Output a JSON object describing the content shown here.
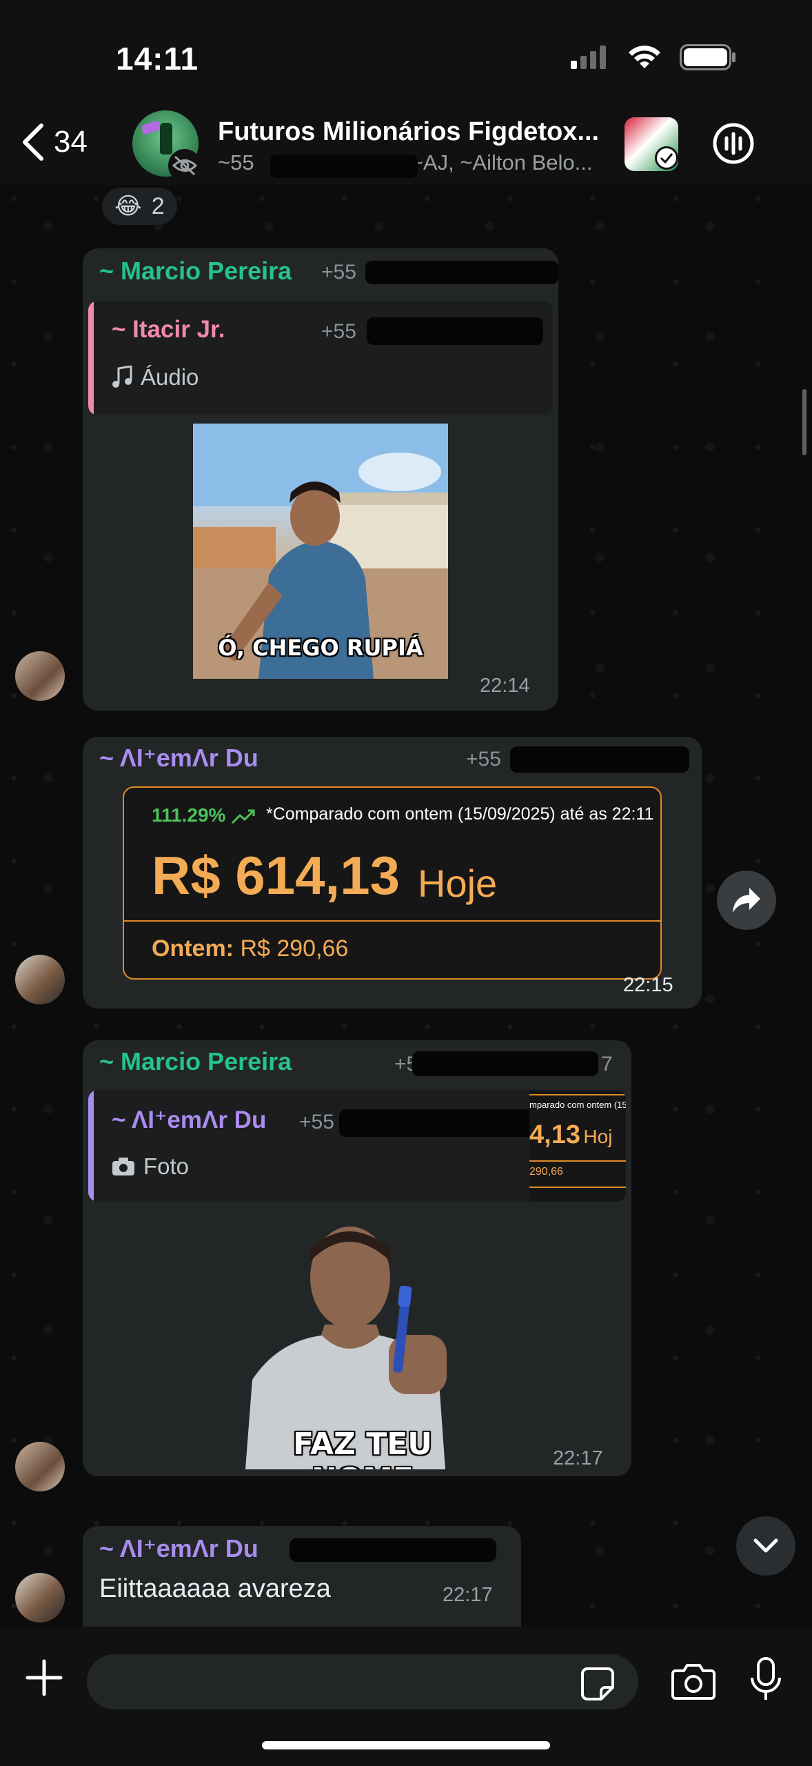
{
  "status_bar": {
    "time": "14:11"
  },
  "header": {
    "back_count": "34",
    "group_title": "Futuros Milionários Figdetox...",
    "members_prefix": "~55",
    "members_suffix": ", ~AJ, ~Ailton Belo..."
  },
  "reaction": {
    "emoji": "😂",
    "count": "2"
  },
  "messages": [
    {
      "sender": "~ Marcio Pereira",
      "phone": "+55",
      "quote": {
        "sender": "~ Itacir Jr.",
        "phone": "+55",
        "kind": "Áudio",
        "icon": "music-note-icon"
      },
      "image_caption": "Ó, CHEGO RUPIÁ",
      "time": "22:14"
    },
    {
      "sender": "~ ΛI⁺emΛr Du",
      "phone": "+55",
      "card": {
        "percent": "111.29%",
        "compared": "*Comparado com ontem (15/09/2025) até as 22:11",
        "amount": "R$ 614,13",
        "today": "Hoje",
        "yesterday_label": "Ontem:",
        "yesterday_value": "R$ 290,66"
      },
      "time": "22:15"
    },
    {
      "sender": "~ Marcio Pereira",
      "phone": "+55",
      "phone_end": "7",
      "quote": {
        "sender": "~ ΛI⁺emΛr Du",
        "phone": "+55",
        "kind": "Foto",
        "icon": "camera-icon",
        "thumb_top": "mparado com ontem (15",
        "thumb_amount": "4,13",
        "thumb_today": "Hoj",
        "thumb_bottom": "290,66"
      },
      "image_caption": "FAZ TEU NOME",
      "time": "22:17"
    },
    {
      "sender": "~ ΛI⁺emΛr Du",
      "text": "Eiittaaaaaa avareza",
      "time": "22:17"
    }
  ],
  "input": {
    "placeholder": ""
  },
  "colors": {
    "marcio": "#25c28c",
    "itacir": "#f08aa8",
    "almir": "#a98cf0",
    "accent_orange": "#f4ab55",
    "positive_green": "#4cc35a"
  }
}
